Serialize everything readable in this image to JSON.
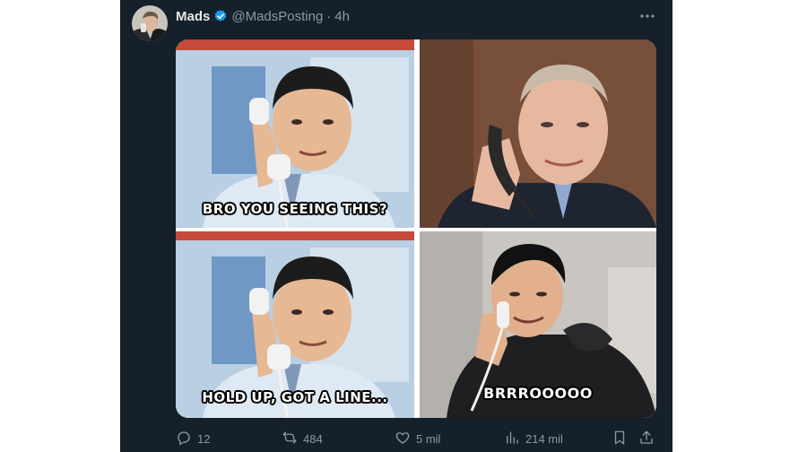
{
  "tweet": {
    "author": {
      "name": "Mads",
      "handle": "@MadsPosting",
      "separator": "·",
      "time": "4h",
      "avatar_icon": "profile-photo",
      "verified_icon": "verified-badge-icon"
    },
    "more_icon": "more-horizontal-icon",
    "media": {
      "panels": [
        {
          "caption": "BRO YOU SEEING THIS?"
        },
        {
          "caption": ""
        },
        {
          "caption": "HOLD UP, GOT A LINE..."
        },
        {
          "caption": "BRRROOOOO"
        }
      ]
    },
    "actions": {
      "replies": "12",
      "reposts": "484",
      "likes": "5 mil",
      "views": "214 mil",
      "reply_icon": "reply-icon",
      "repost_icon": "repost-icon",
      "like_icon": "heart-icon",
      "views_icon": "views-chart-icon",
      "bookmark_icon": "bookmark-icon",
      "share_icon": "share-icon"
    }
  },
  "colors": {
    "background": "#15202b",
    "primary_text": "#e7e9ea",
    "secondary_text": "#8b98a5",
    "verified": "#1d9bf0"
  }
}
